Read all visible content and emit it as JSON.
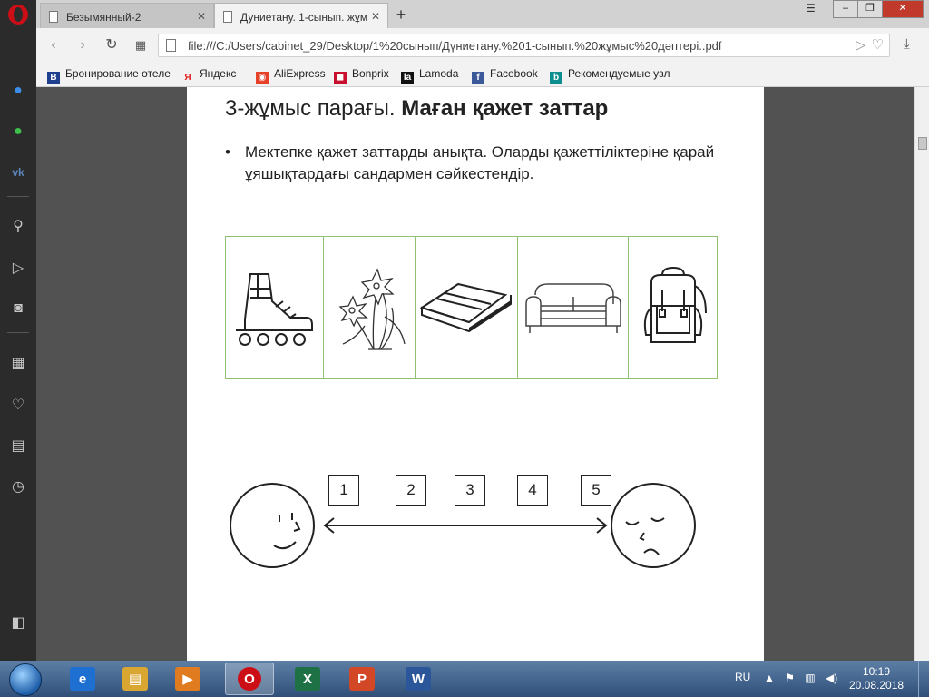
{
  "browser": {
    "tabs": [
      {
        "label": "Безымянный-2",
        "active": false
      },
      {
        "label": "Дуниетану. 1-сынып. жұм",
        "active": true
      }
    ],
    "url": "file:///C:/Users/cabinet_29/Desktop/1%20сынып/Дүниетану.%201-сынып.%20жұмыс%20дәптері..pdf",
    "bookmarks": [
      {
        "label": "Бронирование отеле",
        "icon": "booking-icon",
        "color": "#1f3f8f"
      },
      {
        "label": "Яндекс",
        "icon": "yandex-icon",
        "color": "#e21b1b"
      },
      {
        "label": "AliExpress",
        "icon": "aliexpress-icon",
        "color": "#e8412a"
      },
      {
        "label": "Bonprix",
        "icon": "bonprix-icon",
        "color": "#c8102e"
      },
      {
        "label": "Lamoda",
        "icon": "lamoda-icon",
        "color": "#111111"
      },
      {
        "label": "Facebook",
        "icon": "facebook-icon",
        "color": "#3b5998"
      },
      {
        "label": "Рекомендуемые узл",
        "icon": "bing-icon",
        "color": "#0e8f8f"
      }
    ]
  },
  "document": {
    "heading_prefix": "3-жұмыс парағы.",
    "heading_bold": "Маған қажет заттар",
    "instruction": "Мектепке қажет заттарды анықта. Оларды қажеттіліктеріне қарай ұяшықтардағы сандармен сәйкестендір.",
    "pictures": [
      "roller-skates",
      "flowers",
      "book",
      "sofa",
      "backpack"
    ],
    "scale_numbers": [
      "1",
      "2",
      "3",
      "4",
      "5"
    ]
  },
  "taskbar": {
    "language": "RU",
    "time": "10:19",
    "date": "20.08.2018",
    "apps": [
      {
        "name": "internet-explorer-icon",
        "label": "e",
        "color": "#1d6fd1"
      },
      {
        "name": "file-explorer-icon",
        "label": "▤",
        "color": "#d9a632"
      },
      {
        "name": "media-player-icon",
        "label": "▶",
        "color": "#e07b1f"
      },
      {
        "name": "opera-icon",
        "label": "O",
        "color": "#cc0f16"
      },
      {
        "name": "excel-icon",
        "label": "X",
        "color": "#1e7145"
      },
      {
        "name": "powerpoint-icon",
        "label": "P",
        "color": "#d24726"
      },
      {
        "name": "word-icon",
        "label": "W",
        "color": "#2b579a"
      }
    ]
  }
}
